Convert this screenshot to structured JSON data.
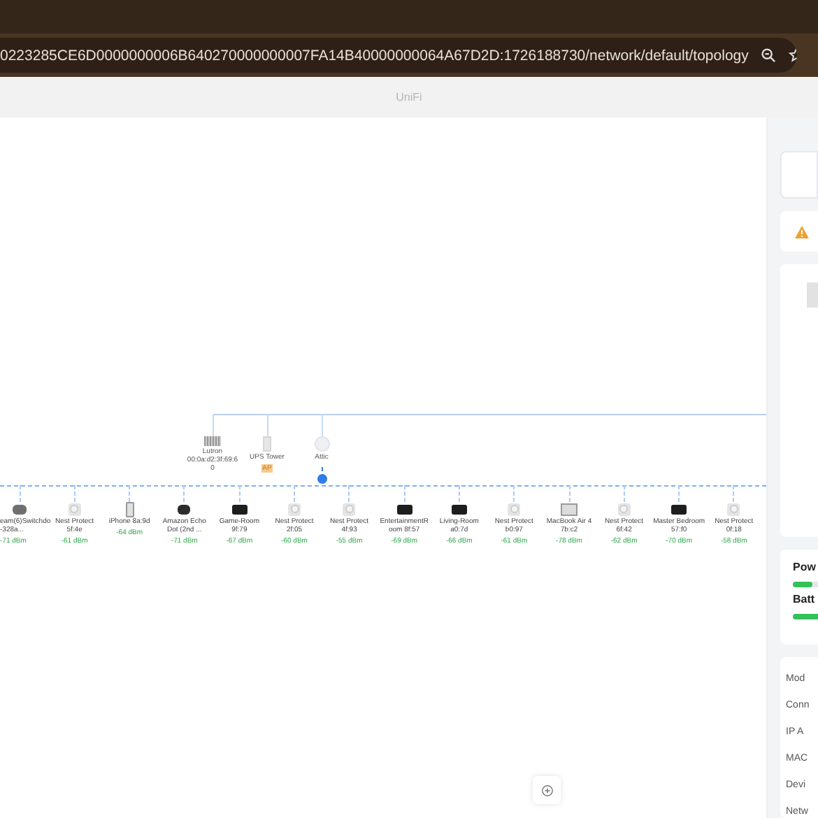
{
  "browser": {
    "url": "0223285CE6D0000000006B640270000000007FA14B40000000064A67D2D:1726188730/network/default/topology"
  },
  "app_title": "UniFi",
  "upstream_nodes": [
    {
      "kind": "device",
      "name": "Lutron 00:0a:d2:3f:69:60"
    },
    {
      "kind": "ups",
      "name": "UPS Tower",
      "badge": "AP"
    },
    {
      "kind": "ap",
      "name": "Attic"
    }
  ],
  "clients": [
    {
      "kind": "switch",
      "name": "eam(6)Switchdo-328a...",
      "signal": "-71 dBm"
    },
    {
      "kind": "nest",
      "name": "Nest Protect 5f:4e",
      "signal": "-61 dBm"
    },
    {
      "kind": "phone",
      "name": "iPhone 8a:9d",
      "signal": "-64 dBm"
    },
    {
      "kind": "echo",
      "name": "Amazon Echo Dot (2nd ...",
      "signal": "-71 dBm"
    },
    {
      "kind": "tv",
      "name": "Game-Room 9f:79",
      "signal": "-67 dBm"
    },
    {
      "kind": "nest",
      "name": "Nest Protect 2f:05",
      "signal": "-60 dBm"
    },
    {
      "kind": "nest",
      "name": "Nest Protect 4f:93",
      "signal": "-55 dBm"
    },
    {
      "kind": "tv",
      "name": "EntertainmentRoom 8f:57",
      "signal": "-69 dBm"
    },
    {
      "kind": "tv",
      "name": "Living-Room a0:7d",
      "signal": "-66 dBm"
    },
    {
      "kind": "nest",
      "name": "Nest Protect b0:97",
      "signal": "-61 dBm"
    },
    {
      "kind": "laptop",
      "name": "MacBook Air 4 7b:c2",
      "signal": "-78 dBm"
    },
    {
      "kind": "nest",
      "name": "Nest Protect 6f:42",
      "signal": "-62 dBm"
    },
    {
      "kind": "tv",
      "name": "Master Bedroom 57:f0",
      "signal": "-70 dBm"
    },
    {
      "kind": "nest",
      "name": "Nest Protect 0f:18",
      "signal": "-58 dBm"
    }
  ],
  "panel": {
    "meters": [
      {
        "label": "Pow",
        "level": 0.12
      },
      {
        "label": "Batt",
        "level": 1
      }
    ],
    "properties": [
      "Mod",
      "Conn",
      "IP A",
      "MAC",
      "Devi",
      "Netw"
    ]
  }
}
